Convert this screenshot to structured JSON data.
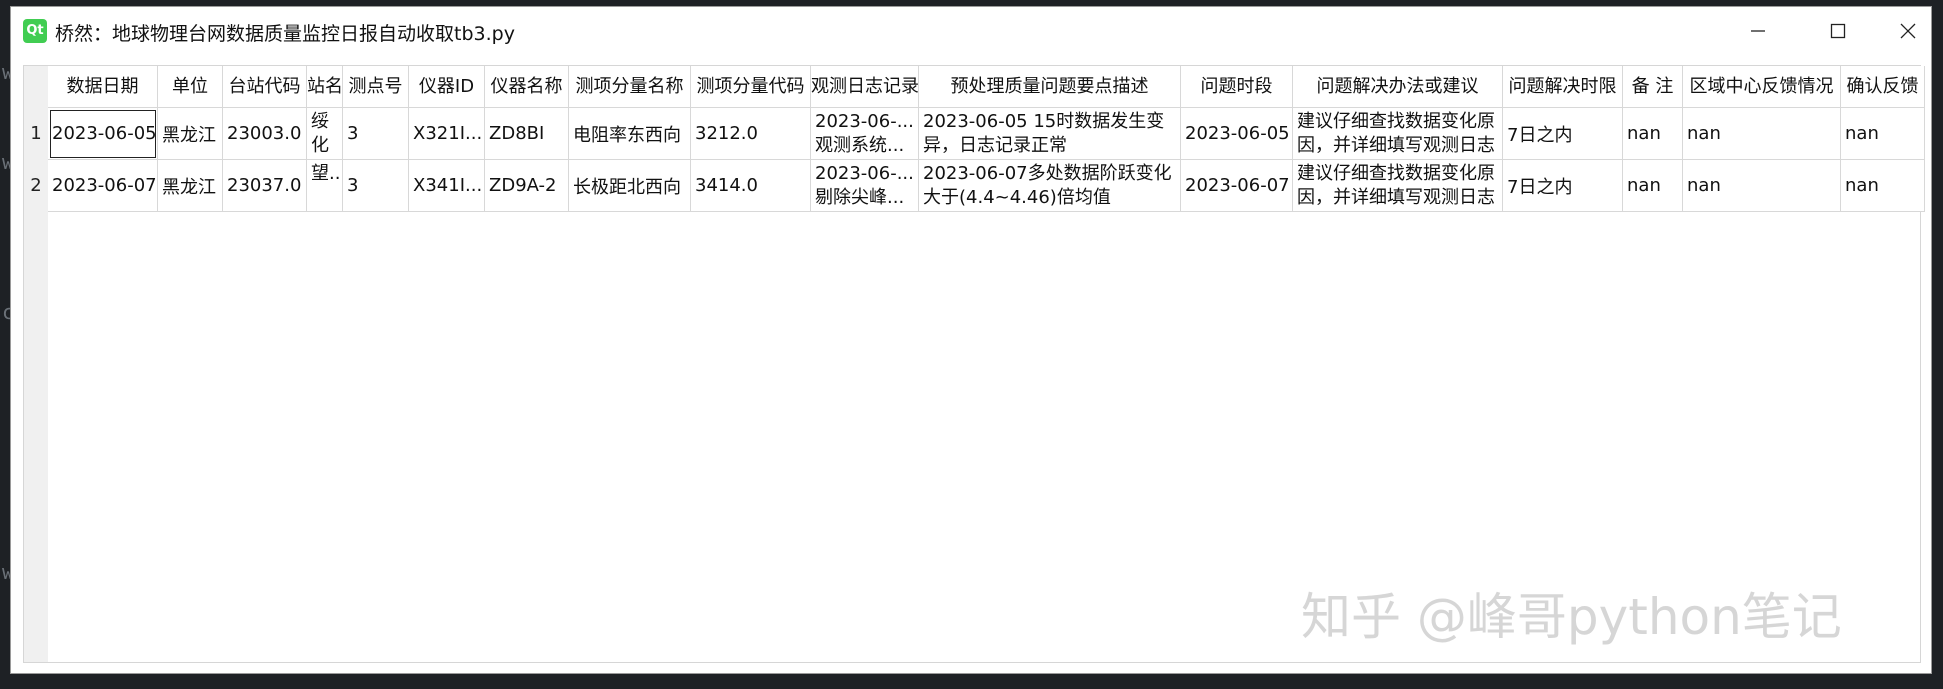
{
  "window": {
    "title": "桥然：地球物理台网数据质量监控日报自动收取tb3.py",
    "icon_text": "Qt"
  },
  "table": {
    "headers": [
      "数据日期",
      "单位",
      "台站代码",
      "站名",
      "测点号",
      "仪器ID",
      "仪器名称",
      "测项分量名称",
      "测项分量代码",
      "观测日志记录",
      "预处理质量问题要点描述",
      "问题时段",
      "问题解决办法或建议",
      "问题解决时限",
      "备 注",
      "区域中心反馈情况",
      "确认反馈"
    ],
    "row_numbers": [
      "1",
      "2"
    ],
    "rows": [
      [
        "2023-06-05",
        "黑龙江",
        "23003.0",
        "绥化",
        "3",
        "X321I...",
        "ZD8BI",
        "电阻率东西向",
        "3212.0",
        "2023-06-... 观测系统...",
        "2023-06-05  15时数据发生变异，日志记录正常",
        "2023-06-05",
        "建议仔细查找数据变化原因，并详细填写观测日志",
        "7日之内",
        "nan",
        "nan",
        "nan"
      ],
      [
        "2023-06-07",
        "黑龙江",
        "23037.0",
        "望...",
        "3",
        "X341I...",
        "ZD9A-2",
        "长极距北西向",
        "3414.0",
        "2023-06-... 剔除尖峰...",
        "2023-06-07多处数据阶跃变化大于(4.4~4.46)倍均值",
        "2023-06-07",
        "建议仔细查找数据变化原因，并详细填写观测日志",
        "7日之内",
        "nan",
        "nan",
        "nan"
      ]
    ]
  },
  "watermark": "知乎 @峰哥python笔记"
}
